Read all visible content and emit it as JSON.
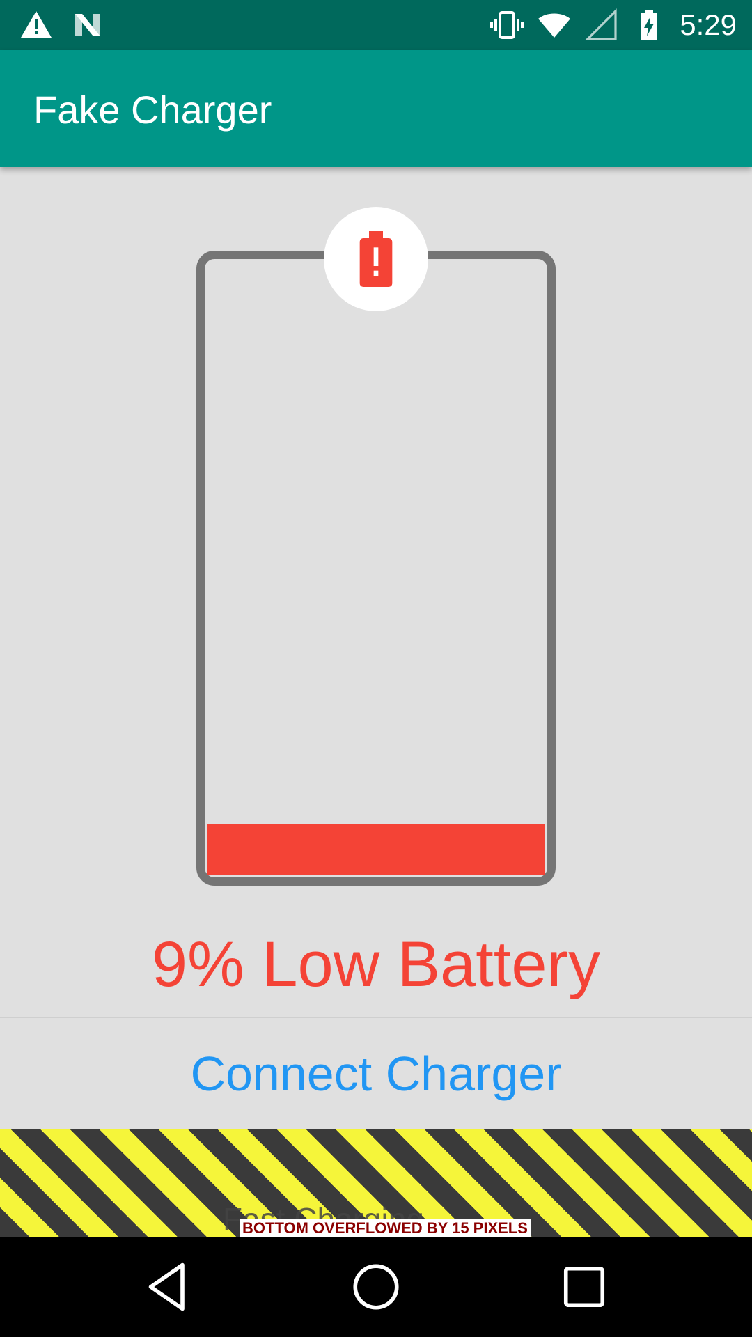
{
  "status_bar": {
    "time": "5:29",
    "icons": [
      "warning-icon",
      "n-logo-icon",
      "vibrate-icon",
      "wifi-icon",
      "signal-icon",
      "battery-charging-icon"
    ]
  },
  "app_bar": {
    "title": "Fake Charger"
  },
  "battery": {
    "level_percent": 9,
    "fill_color": "#f44336",
    "outline_color": "#757575",
    "badge_icon": "battery-alert-icon",
    "status_text": "9% Low Battery",
    "status_color": "#f44336"
  },
  "actions": {
    "connect_label": "Connect Charger",
    "connect_color": "#2196f3",
    "fast_charging_label": "Fast Charging"
  },
  "overflow_warning": {
    "text": "BOTTOM OVERFLOWED BY 15 PIXELS"
  },
  "nav_bar": {
    "buttons": [
      "back-icon",
      "home-icon",
      "recents-icon"
    ]
  },
  "colors": {
    "status_bar": "#00695c",
    "app_bar": "#009688",
    "background": "#e0e0e0"
  }
}
